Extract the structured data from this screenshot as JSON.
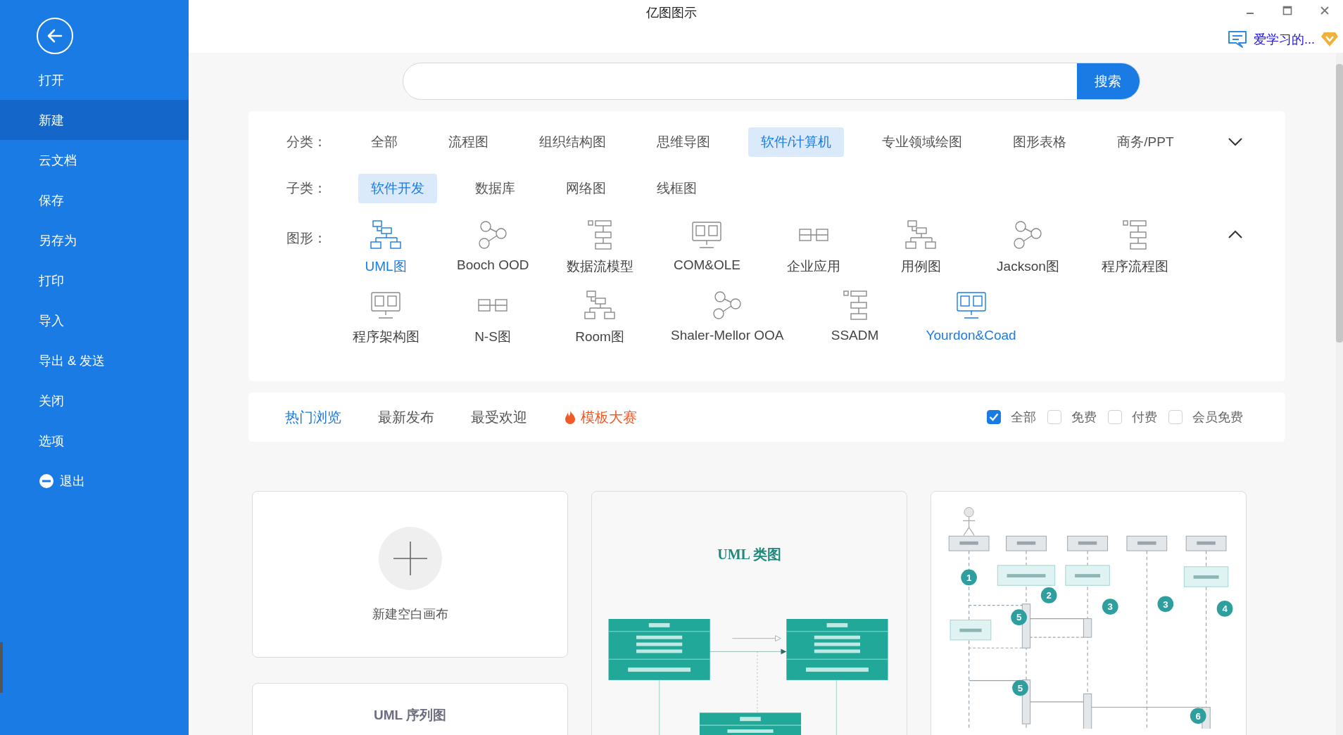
{
  "window": {
    "title": "亿图图示"
  },
  "user": {
    "name": "爱学习的..."
  },
  "sidebar": {
    "items": [
      {
        "label": "打开",
        "selected": false
      },
      {
        "label": "新建",
        "selected": true
      },
      {
        "label": "云文档",
        "selected": false
      },
      {
        "label": "保存",
        "selected": false
      },
      {
        "label": "另存为",
        "selected": false
      },
      {
        "label": "打印",
        "selected": false
      },
      {
        "label": "导入",
        "selected": false
      },
      {
        "label": "导出 & 发送",
        "selected": false
      },
      {
        "label": "关闭",
        "selected": false
      },
      {
        "label": "选项",
        "selected": false
      },
      {
        "label": "退出",
        "selected": false,
        "kind": "exit"
      }
    ]
  },
  "search": {
    "button": "搜索"
  },
  "categories": {
    "label": "分类：",
    "items": [
      {
        "label": "全部",
        "selected": false
      },
      {
        "label": "流程图",
        "selected": false
      },
      {
        "label": "组织结构图",
        "selected": false
      },
      {
        "label": "思维导图",
        "selected": false
      },
      {
        "label": "软件/计算机",
        "selected": true
      },
      {
        "label": "专业领域绘图",
        "selected": false
      },
      {
        "label": "图形表格",
        "selected": false
      },
      {
        "label": "商务/PPT",
        "selected": false
      }
    ]
  },
  "subcategories": {
    "label": "子类：",
    "items": [
      {
        "label": "软件开发",
        "selected": true
      },
      {
        "label": "数据库",
        "selected": false
      },
      {
        "label": "网络图",
        "selected": false
      },
      {
        "label": "线框图",
        "selected": false
      }
    ]
  },
  "shapes": {
    "label": "图形：",
    "items": [
      {
        "label": "UML图",
        "selected": true
      },
      {
        "label": "Booch OOD",
        "selected": false
      },
      {
        "label": "数据流模型",
        "selected": false
      },
      {
        "label": "COM&OLE",
        "selected": false
      },
      {
        "label": "企业应用",
        "selected": false
      },
      {
        "label": "用例图",
        "selected": false
      },
      {
        "label": "Jackson图",
        "selected": false
      },
      {
        "label": "程序流程图",
        "selected": false
      },
      {
        "label": "程序架构图",
        "selected": false
      },
      {
        "label": "N-S图",
        "selected": false
      },
      {
        "label": "Room图",
        "selected": false
      },
      {
        "label": "Shaler-Mellor OOA",
        "selected": false
      },
      {
        "label": "SSADM",
        "selected": false
      },
      {
        "label": "Yourdon&Coad",
        "selected": true
      }
    ]
  },
  "tabs": [
    {
      "label": "热门浏览",
      "selected": true
    },
    {
      "label": "最新发布",
      "selected": false
    },
    {
      "label": "最受欢迎",
      "selected": false
    },
    {
      "label": "模板大赛",
      "selected": false,
      "kind": "hot"
    }
  ],
  "filters": [
    {
      "label": "全部",
      "checked": true
    },
    {
      "label": "免费",
      "checked": false
    },
    {
      "label": "付费",
      "checked": false
    },
    {
      "label": "会员免费",
      "checked": false
    }
  ],
  "template_columns": [
    [
      {
        "kind": "blank",
        "label": "新建空白画布"
      },
      {
        "kind": "title",
        "label": "UML 序列图"
      }
    ],
    [
      {
        "kind": "class",
        "title": "UML 类图"
      }
    ],
    [
      {
        "kind": "sequence",
        "steps": [
          "1",
          "2",
          "3",
          "3",
          "4",
          "5",
          "5",
          "6"
        ]
      }
    ]
  ]
}
